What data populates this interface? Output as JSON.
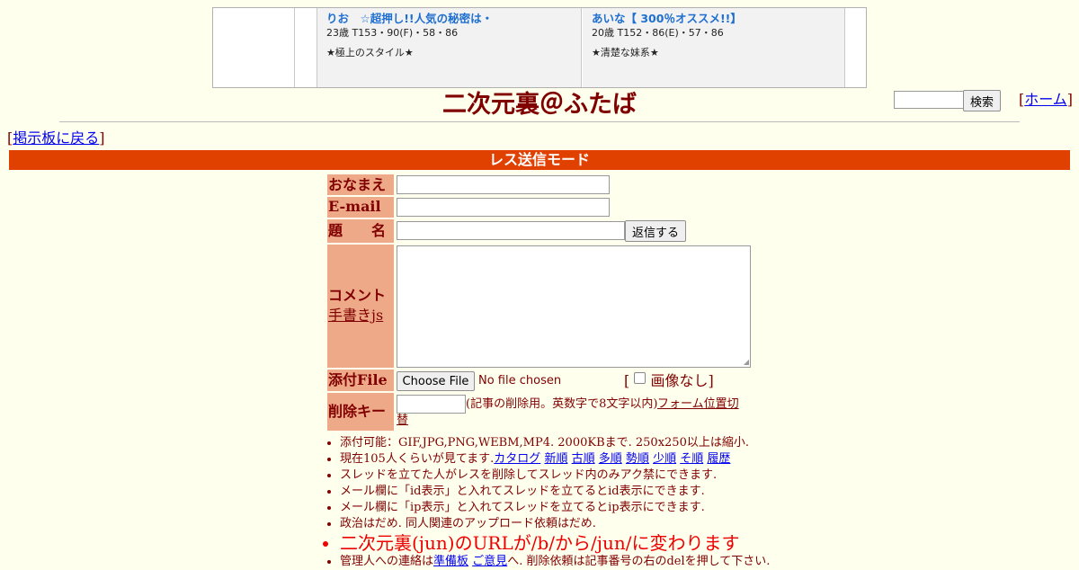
{
  "ads": [
    {
      "title": "りお　☆超押し!!人気の秘密は・",
      "meta": "23歳 T153・90(F)・58・86",
      "desc": "★極上のスタイル★"
    },
    {
      "title": "あいな【 300％オススメ!!】",
      "meta": "20歳 T152・86(E)・57・86",
      "desc": "★清楚な妹系★"
    }
  ],
  "header": {
    "site_title": "二次元裏＠ふたば",
    "search_button": "検索",
    "home_link": "ホーム",
    "back_link": "掲示板に戻る"
  },
  "mode_bar": "レス送信モード",
  "form": {
    "name_label": "おなまえ",
    "email_label": "E-mail",
    "subject_label": "題　　名",
    "submit_button": "返信する",
    "comment_label": "コメント",
    "handwrite_link": "手書きjs",
    "file_label": "添付File",
    "choose_file_button": "Choose File",
    "no_file_text": "No file chosen",
    "no_image_label": "画像なし",
    "delkey_label": "削除キー",
    "delkey_note": "(記事の削除用。英数字で8文字以内)",
    "form_position_link": "フォーム位置切替"
  },
  "rules": {
    "attach": "添付可能：GIF,JPG,PNG,WEBM,MP4. 2000KBまで. 250x250以上は縮小.",
    "viewers_prefix": "現在105人くらいが見てます.",
    "view_links": [
      "カタログ",
      "新順",
      "古順",
      "多順",
      "勢順",
      "少順",
      "そ順",
      "履歴"
    ],
    "thread_owner": "スレッドを立てた人がレスを削除してスレッド内のみアク禁にできます.",
    "id_display": "メール欄に「id表示」と入れてスレッドを立てるとid表示にできます.",
    "ip_display": "メール欄に「ip表示」と入れてスレッドを立てるとip表示にできます.",
    "politics": "政治はだめ. 同人関連のアップロード依頼はだめ.",
    "url_change": "二次元裏(jun)のURLが/b/から/jun/に変わります",
    "contact_prefix": "管理人への連絡は",
    "contact_link1": "準備板",
    "contact_link2": "ご意見",
    "contact_suffix": "へ. 削除依頼は記事番号の右のdelを押して下さい."
  },
  "colors": {
    "background": "#ffffee",
    "text": "#800000",
    "mode_bar": "#e04000",
    "label_bg": "#eeaa88",
    "notice_red": "#ee0000"
  }
}
